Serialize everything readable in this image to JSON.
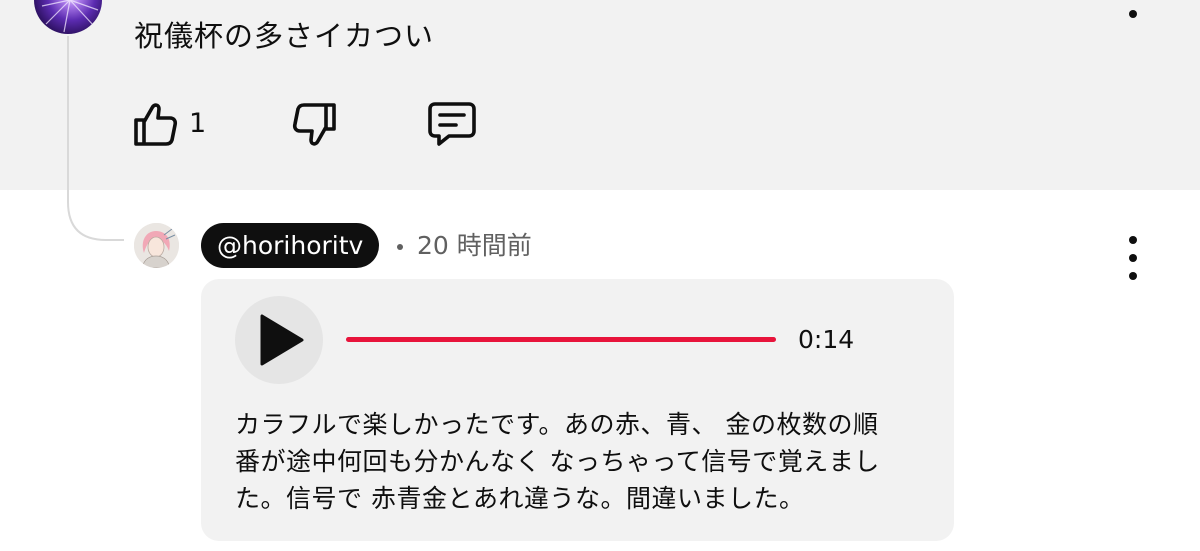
{
  "parent_comment": {
    "text": "祝儀杯の多さイカつい",
    "like_count": "1",
    "icons": {
      "avatar": "channel-avatar-image",
      "like": "thumbs-up-icon",
      "dislike": "thumbs-down-icon",
      "reply": "reply-comment-icon",
      "menu": "more-vertical-icon"
    }
  },
  "reply": {
    "handle": "@horihoritv",
    "separator": "•",
    "time_ago": "20 時間前",
    "icons": {
      "avatar": "user-avatar-image",
      "menu": "more-vertical-icon"
    },
    "voice_message": {
      "duration": "0:14",
      "progress": 1.0,
      "play_icon": "play-icon",
      "transcript_lines": [
        "カラフルで楽しかったです。あの赤、青、 金の枚数の順",
        "番が途中何回も分かんなく なっちゃって信号で覚えまし",
        "た。信号で 赤青金とあれ違うな。間違いました。"
      ]
    }
  },
  "colors": {
    "page_bg": "#ffffff",
    "highlighted_bg": "#f2f2f2",
    "progress_accent": "#e8143b",
    "handle_chip_bg": "#0f0f0f",
    "secondary_text": "#606060"
  }
}
